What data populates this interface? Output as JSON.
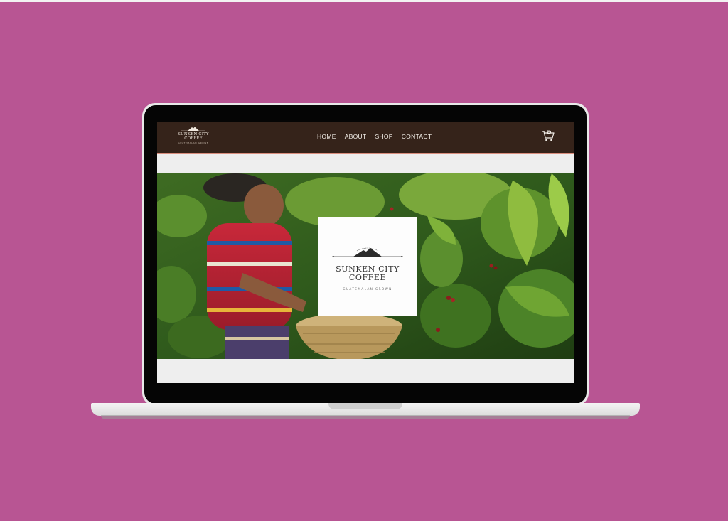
{
  "site": {
    "logo": {
      "line1": "SUNKEN CITY",
      "line2": "COFFEE",
      "tagline": "GUATEMALAN GROWN"
    },
    "nav": [
      {
        "label": "HOME"
      },
      {
        "label": "ABOUT"
      },
      {
        "label": "SHOP"
      },
      {
        "label": "CONTACT"
      }
    ],
    "cart": {
      "count": "0"
    }
  },
  "hero": {
    "brand": {
      "line1": "SUNKEN CITY",
      "line2": "COFFEE",
      "tagline": "GUATEMALAN GROWN"
    }
  },
  "colors": {
    "background": "#b85593",
    "header": "#35231a",
    "header_accent": "#d98d7d",
    "screen_bg": "#eeeeee"
  },
  "icons": {
    "cart": "shopping-cart-icon",
    "logo": "mountain-logo-icon"
  }
}
